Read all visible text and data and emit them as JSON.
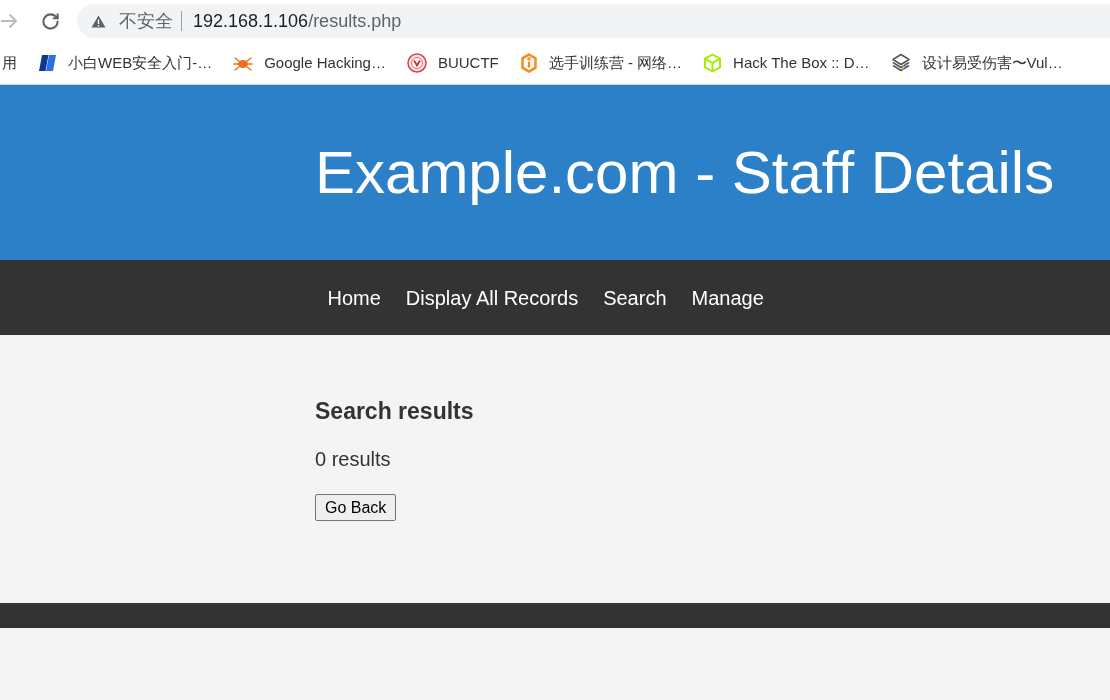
{
  "toolbar": {
    "forward": {
      "disabled": true
    },
    "security_label": "不安全",
    "url": {
      "host": "192.168.1.106",
      "path": "/results.php"
    }
  },
  "bookmarks": [
    {
      "kind": "apps",
      "label": "用"
    },
    {
      "kind": "site",
      "label": "小白WEB安全入门-…"
    },
    {
      "kind": "site",
      "label": "Google Hacking…"
    },
    {
      "kind": "site",
      "label": "BUUCTF"
    },
    {
      "kind": "site",
      "label": "选手训练营 - 网络…"
    },
    {
      "kind": "site",
      "label": "Hack The Box :: D…"
    },
    {
      "kind": "site",
      "label": "设计易受伤害〜Vul…"
    }
  ],
  "site": {
    "title": "Example.com - Staff Details",
    "nav": [
      {
        "label": "Home"
      },
      {
        "label": "Display All Records"
      },
      {
        "label": "Search"
      },
      {
        "label": "Manage"
      }
    ],
    "content": {
      "heading": "Search results",
      "count": "0 results",
      "button": "Go Back"
    }
  }
}
